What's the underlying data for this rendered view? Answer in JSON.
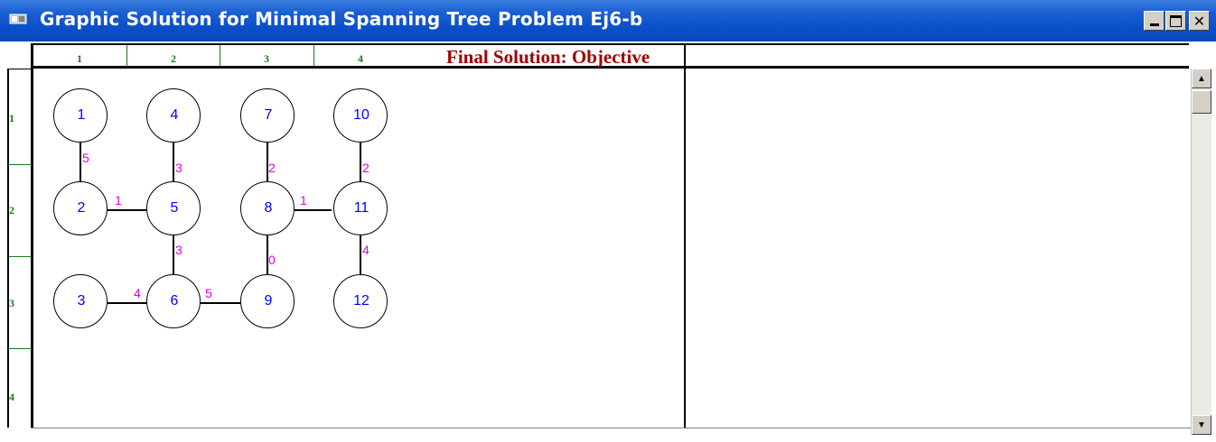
{
  "window": {
    "title": "Graphic Solution for Minimal Spanning Tree Problem Ej6-b",
    "minimize_label": "_",
    "maximize_label": "☐",
    "close_label": "✕"
  },
  "grid": {
    "column_labels": [
      "1",
      "2",
      "3",
      "4"
    ],
    "row_labels": [
      "1",
      "2",
      "3",
      "4"
    ],
    "header_text": "Final Solution: Objective"
  },
  "graph": {
    "nodes": [
      "1",
      "4",
      "7",
      "10",
      "2",
      "5",
      "8",
      "11",
      "3",
      "6",
      "9",
      "12"
    ],
    "edge_weights": {
      "e_1_2": "5",
      "e_4_5": "3",
      "e_7_8": "2",
      "e_10_11": "2",
      "e_2_5": "1",
      "e_8_11": "1",
      "e_5_6": "3",
      "e_8_9": "0",
      "e_11_12": "4",
      "e_3_6": "4",
      "e_6_9": "5"
    }
  },
  "colors": {
    "title_bar": "#0a4ec8",
    "node_label": "#0000ff",
    "edge_weight": "#e000e0",
    "grid_label": "#1a7a1a",
    "objective_text": "#a00000"
  },
  "scrollbar": {
    "up_icon": "up-arrow-icon",
    "down_icon": "down-arrow-icon"
  }
}
